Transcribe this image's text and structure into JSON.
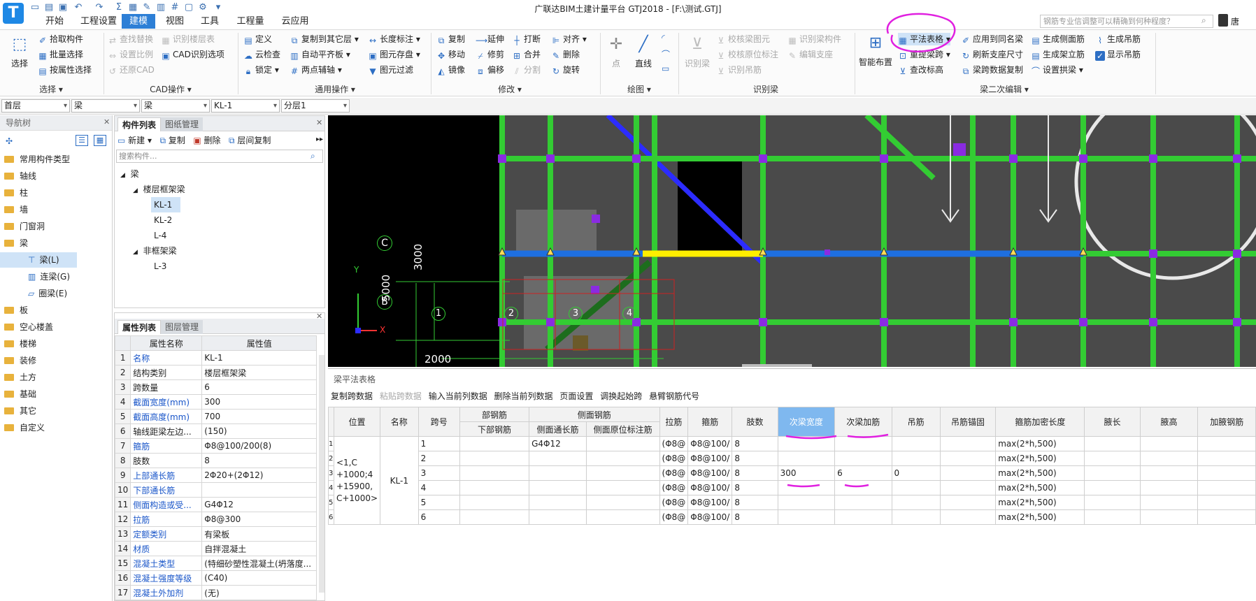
{
  "window": {
    "title": "广联达BIM土建计量平台 GTJ2018 - [F:\\测试.GTJ]",
    "logo_letter": "T"
  },
  "menu": {
    "tabs": [
      "开始",
      "工程设置",
      "建模",
      "视图",
      "工具",
      "工程量",
      "云应用"
    ],
    "active": "建模"
  },
  "search": {
    "placeholder": "钢筋专业信调整可以精确到何种程度？"
  },
  "user": {
    "name": "唐"
  },
  "ribbon": {
    "select": {
      "label": "选择",
      "items": [
        "拾取构件",
        "批量选择",
        "按属性选择"
      ],
      "group": "选择 ▾"
    },
    "cad": {
      "items": [
        "查找替换",
        "识别楼层表",
        "设置比例",
        "CAD识别选项",
        "还原CAD"
      ],
      "group": "CAD操作 ▾"
    },
    "common": {
      "items": [
        "定义",
        "复制到其它层 ▾",
        "长度标注 ▾",
        "云检查",
        "自动平齐板 ▾",
        "图元存盘 ▾",
        "锁定 ▾",
        "两点辅轴 ▾",
        "图元过滤"
      ],
      "group": "通用操作 ▾"
    },
    "modify": {
      "items": [
        "复制",
        "延伸",
        "打断",
        "对齐 ▾",
        "移动",
        "修剪",
        "合并",
        "删除",
        "镜像",
        "偏移",
        "分割",
        "旋转"
      ],
      "group": "修改 ▾"
    },
    "draw": {
      "items": [
        "点",
        "直线"
      ],
      "group": "绘图 ▾"
    },
    "identify": {
      "items": [
        "识别梁",
        "校核梁图元",
        "识别梁构件",
        "校核原位标注",
        "编辑支座",
        "识别吊筋"
      ],
      "group": "识别梁"
    },
    "secondary": {
      "big": "智能布置",
      "items": [
        "平法表格 ▾",
        "应用到同名梁",
        "生成侧面筋",
        "生成吊筋",
        "重提梁跨 ▾",
        "刷新支座尺寸",
        "生成架立筋",
        "显示吊筋",
        "查改标高",
        "梁跨数据复制",
        "设置拱梁 ▾"
      ],
      "group": "梁二次编辑 ▾"
    }
  },
  "combos": [
    "首层",
    "梁",
    "梁",
    "KL-1",
    "分层1"
  ],
  "nav": {
    "title": "导航树",
    "items": [
      "常用构件类型",
      "轴线",
      "柱",
      "墙",
      "门窗洞",
      "梁",
      "板",
      "空心楼盖",
      "楼梯",
      "装修",
      "土方",
      "基础",
      "其它",
      "自定义"
    ],
    "sub_items": [
      "梁(L)",
      "连梁(G)",
      "圈梁(E)"
    ]
  },
  "component_list": {
    "tabs": [
      "构件列表",
      "图纸管理"
    ],
    "toolbar": [
      "新建 ▾",
      "复制",
      "删除",
      "层间复制"
    ],
    "search_placeholder": "搜索构件...",
    "tree": {
      "root": "梁",
      "group1": "楼层框架梁",
      "group1_items": [
        "KL-1",
        "KL-2",
        "L-4"
      ],
      "group2": "非框架梁",
      "group2_items": [
        "L-3"
      ]
    }
  },
  "property_list": {
    "tabs": [
      "属性列表",
      "图层管理"
    ],
    "headers": [
      "属性名称",
      "属性值"
    ],
    "rows": [
      {
        "n": "1",
        "name": "名称",
        "value": "KL-1"
      },
      {
        "n": "2",
        "name": "结构类别",
        "value": "楼层框架梁"
      },
      {
        "n": "3",
        "name": "跨数量",
        "value": "6"
      },
      {
        "n": "4",
        "name": "截面宽度(mm)",
        "value": "300"
      },
      {
        "n": "5",
        "name": "截面高度(mm)",
        "value": "700"
      },
      {
        "n": "6",
        "name": "轴线距梁左边...",
        "value": "(150)"
      },
      {
        "n": "7",
        "name": "箍筋",
        "value": "Φ8@100/200(8)"
      },
      {
        "n": "8",
        "name": "肢数",
        "value": "8"
      },
      {
        "n": "9",
        "name": "上部通长筋",
        "value": "2Φ20+(2Φ12)"
      },
      {
        "n": "10",
        "name": "下部通长筋",
        "value": ""
      },
      {
        "n": "11",
        "name": "侧面构造或受...",
        "value": "G4Φ12"
      },
      {
        "n": "12",
        "name": "拉筋",
        "value": "Φ8@300"
      },
      {
        "n": "13",
        "name": "定额类别",
        "value": "有梁板"
      },
      {
        "n": "14",
        "name": "材质",
        "value": "自拌混凝土"
      },
      {
        "n": "15",
        "name": "混凝土类型",
        "value": "(特细砂塑性混凝土(坍落度..."
      },
      {
        "n": "16",
        "name": "混凝土强度等级",
        "value": "(C40)"
      },
      {
        "n": "17",
        "name": "混凝土外加剂",
        "value": "(无)"
      }
    ]
  },
  "canvas": {
    "axis_labels": [
      "C",
      "B",
      "1",
      "2",
      "3",
      "4"
    ],
    "dims": [
      "3000",
      "5000",
      "2000"
    ],
    "ucs": [
      "Y",
      "X"
    ]
  },
  "beam_table": {
    "title": "梁平法表格",
    "toolbar": [
      "复制跨数据",
      "粘贴跨数据",
      "输入当前列数据",
      "删除当前列数据",
      "页面设置",
      "调换起始跨",
      "悬臂钢筋代号"
    ],
    "group_headers": [
      "部钢筋",
      "侧面钢筋"
    ],
    "headers": [
      "位置",
      "名称",
      "跨号",
      "下部钢筋",
      "侧面通长筋",
      "侧面原位标注筋",
      "拉筋",
      "箍筋",
      "肢数",
      "次梁宽度",
      "次梁加筋",
      "吊筋",
      "吊筋锚固",
      "箍筋加密长度",
      "腋长",
      "腋高",
      "加腋钢筋"
    ],
    "position": "<1,C\n+1000;4\n+15900,\nC+1000>",
    "name": "KL-1",
    "rows": [
      {
        "rn": "1",
        "span": "1",
        "side": "G4Φ12",
        "tie": "(Φ8@",
        "stirrup": "Φ8@100/",
        "legs": "8",
        "sb_w": "",
        "sb_add": "",
        "hang": "",
        "dense": "max(2*h,500)"
      },
      {
        "rn": "2",
        "span": "2",
        "side": "",
        "tie": "(Φ8@",
        "stirrup": "Φ8@100/",
        "legs": "8",
        "sb_w": "",
        "sb_add": "",
        "hang": "",
        "dense": "max(2*h,500)"
      },
      {
        "rn": "3",
        "span": "3",
        "side": "",
        "tie": "(Φ8@",
        "stirrup": "Φ8@100/",
        "legs": "8",
        "sb_w": "300",
        "sb_add": "6",
        "hang": "0",
        "dense": "max(2*h,500)"
      },
      {
        "rn": "4",
        "span": "4",
        "side": "",
        "tie": "(Φ8@",
        "stirrup": "Φ8@100/",
        "legs": "8",
        "sb_w": "",
        "sb_add": "",
        "hang": "",
        "dense": "max(2*h,500)"
      },
      {
        "rn": "5",
        "span": "5",
        "side": "",
        "tie": "(Φ8@",
        "stirrup": "Φ8@100/",
        "legs": "8",
        "sb_w": "",
        "sb_add": "",
        "hang": "",
        "dense": "max(2*h,500)"
      },
      {
        "rn": "6",
        "span": "6",
        "side": "",
        "tie": "(Φ8@",
        "stirrup": "Φ8@100/",
        "legs": "8",
        "sb_w": "",
        "sb_add": "",
        "hang": "",
        "dense": "max(2*h,500)"
      }
    ]
  },
  "colors": {
    "accent": "#2d7fd6",
    "grid_green": "#33cc33",
    "column_purple": "#8a2be2",
    "beam_blue": "#1e6fe0",
    "beam_yellow": "#ffee00",
    "annotation_magenta": "#e020e0"
  }
}
